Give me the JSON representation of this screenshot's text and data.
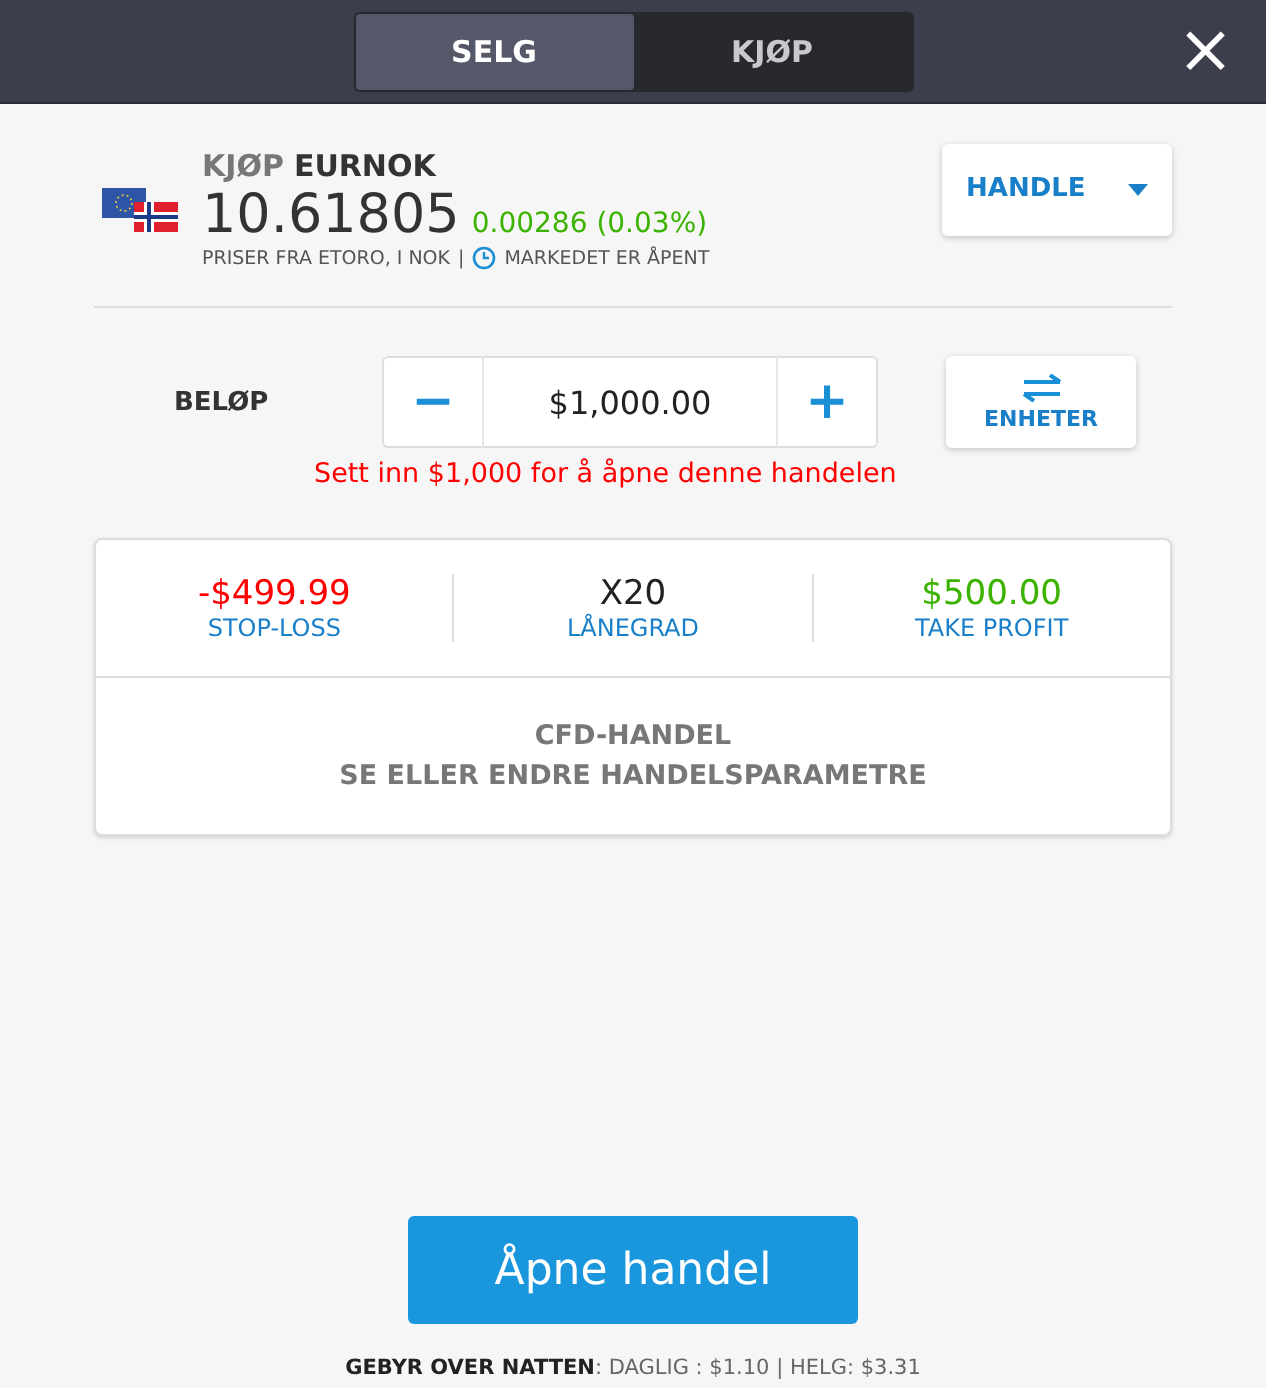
{
  "tabs": [
    {
      "label": "SELG",
      "selected": true
    },
    {
      "label": "KJØP",
      "selected": false
    }
  ],
  "close": "×",
  "instrument": {
    "action": "KJØP",
    "symbol": "EURNOK",
    "price": "10.61805",
    "change": "0.00286 (0.03%)",
    "source": "PRISER FRA ETORO, I NOK",
    "separator": "|",
    "market_status": "MARKEDET ER ÅPENT"
  },
  "trade_menu": {
    "label": "HANDLE"
  },
  "amount": {
    "label": "BELØP",
    "minus": "−",
    "value": "$1,000.00",
    "plus": "+",
    "units_button": "ENHETER",
    "error": "Sett inn $1,000 for å åpne denne handelen"
  },
  "stats": [
    {
      "value": "-$499.99",
      "label": "STOP-LOSS",
      "color": "#ff0000"
    },
    {
      "value": "X20",
      "label": "LÅNEGRAD",
      "color": "#222222"
    },
    {
      "value": "$500.00",
      "label": "TAKE PROFIT",
      "color": "#3cb300"
    }
  ],
  "parameters": {
    "title": "CFD-HANDEL",
    "subtitle": "SE ELLER ENDRE HANDELSPARAMETRE"
  },
  "open_button": "Åpne handel",
  "fees": "**GEBYR OVER NATTEN**: DAGLIG : $1.10 | HELG: $3.31"
}
